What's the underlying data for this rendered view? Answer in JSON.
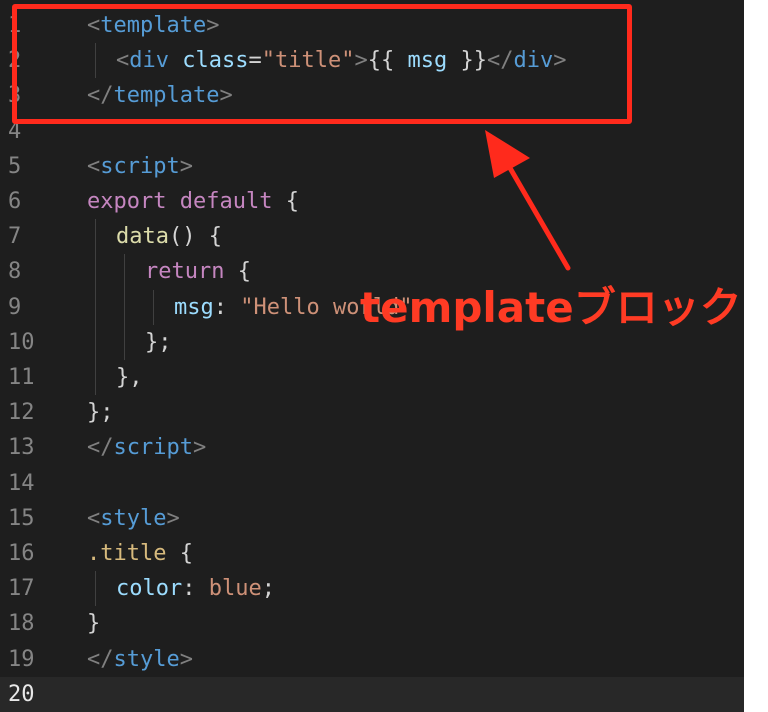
{
  "editor": {
    "lines": [
      {
        "n": "1",
        "tokens": [
          {
            "t": "<",
            "c": "punct"
          },
          {
            "t": "template",
            "c": "tag"
          },
          {
            "t": ">",
            "c": "punct"
          }
        ]
      },
      {
        "n": "2",
        "tokens": [
          {
            "t": "<",
            "c": "punct"
          },
          {
            "t": "div",
            "c": "tag"
          },
          {
            "t": " ",
            "c": "plain"
          },
          {
            "t": "class",
            "c": "attr"
          },
          {
            "t": "=",
            "c": "plain"
          },
          {
            "t": "\"title\"",
            "c": "str"
          },
          {
            "t": ">",
            "c": "punct"
          },
          {
            "t": "{{ ",
            "c": "plain"
          },
          {
            "t": "msg",
            "c": "attr"
          },
          {
            "t": " }}",
            "c": "plain"
          },
          {
            "t": "</",
            "c": "punct"
          },
          {
            "t": "div",
            "c": "tag"
          },
          {
            "t": ">",
            "c": "punct"
          }
        ]
      },
      {
        "n": "3",
        "tokens": [
          {
            "t": "</",
            "c": "punct"
          },
          {
            "t": "template",
            "c": "tag"
          },
          {
            "t": ">",
            "c": "punct"
          }
        ]
      },
      {
        "n": "4",
        "tokens": []
      },
      {
        "n": "5",
        "tokens": [
          {
            "t": "<",
            "c": "punct"
          },
          {
            "t": "script",
            "c": "tag"
          },
          {
            "t": ">",
            "c": "punct"
          }
        ]
      },
      {
        "n": "6",
        "tokens": [
          {
            "t": "export",
            "c": "kw"
          },
          {
            "t": " ",
            "c": "plain"
          },
          {
            "t": "default",
            "c": "kw"
          },
          {
            "t": " {",
            "c": "plain"
          }
        ]
      },
      {
        "n": "7",
        "tokens": [
          {
            "t": "data",
            "c": "fn"
          },
          {
            "t": "() {",
            "c": "plain"
          }
        ]
      },
      {
        "n": "8",
        "tokens": [
          {
            "t": "return",
            "c": "kw"
          },
          {
            "t": " {",
            "c": "plain"
          }
        ]
      },
      {
        "n": "9",
        "tokens": [
          {
            "t": "msg",
            "c": "attr"
          },
          {
            "t": ": ",
            "c": "plain"
          },
          {
            "t": "\"Hello world\"",
            "c": "str"
          }
        ]
      },
      {
        "n": "10",
        "tokens": [
          {
            "t": "};",
            "c": "plain"
          }
        ]
      },
      {
        "n": "11",
        "tokens": [
          {
            "t": "},",
            "c": "plain"
          }
        ]
      },
      {
        "n": "12",
        "tokens": [
          {
            "t": "};",
            "c": "plain"
          }
        ]
      },
      {
        "n": "13",
        "tokens": [
          {
            "t": "</",
            "c": "punct"
          },
          {
            "t": "script",
            "c": "tag"
          },
          {
            "t": ">",
            "c": "punct"
          }
        ]
      },
      {
        "n": "14",
        "tokens": []
      },
      {
        "n": "15",
        "tokens": [
          {
            "t": "<",
            "c": "punct"
          },
          {
            "t": "style",
            "c": "tag"
          },
          {
            "t": ">",
            "c": "punct"
          }
        ]
      },
      {
        "n": "16",
        "tokens": [
          {
            "t": ".title",
            "c": "sel"
          },
          {
            "t": " {",
            "c": "plain"
          }
        ]
      },
      {
        "n": "17",
        "tokens": [
          {
            "t": "color",
            "c": "attr"
          },
          {
            "t": ": ",
            "c": "plain"
          },
          {
            "t": "blue",
            "c": "str"
          },
          {
            "t": ";",
            "c": "plain"
          }
        ]
      },
      {
        "n": "18",
        "tokens": [
          {
            "t": "}",
            "c": "plain"
          }
        ]
      },
      {
        "n": "19",
        "tokens": [
          {
            "t": "</",
            "c": "punct"
          },
          {
            "t": "style",
            "c": "tag"
          },
          {
            "t": ">",
            "c": "punct"
          }
        ]
      },
      {
        "n": "20",
        "tokens": []
      }
    ],
    "active_line": "20",
    "colors": {
      "background": "#1e1e1e",
      "tag": "#569cd6",
      "attr": "#9cdcfe",
      "string": "#ce9178",
      "keyword": "#c586c0",
      "function": "#dcdcaa",
      "selector": "#d7ba7d"
    }
  },
  "annotation": {
    "label": "templateブロック",
    "color": "#ff2a1c"
  }
}
